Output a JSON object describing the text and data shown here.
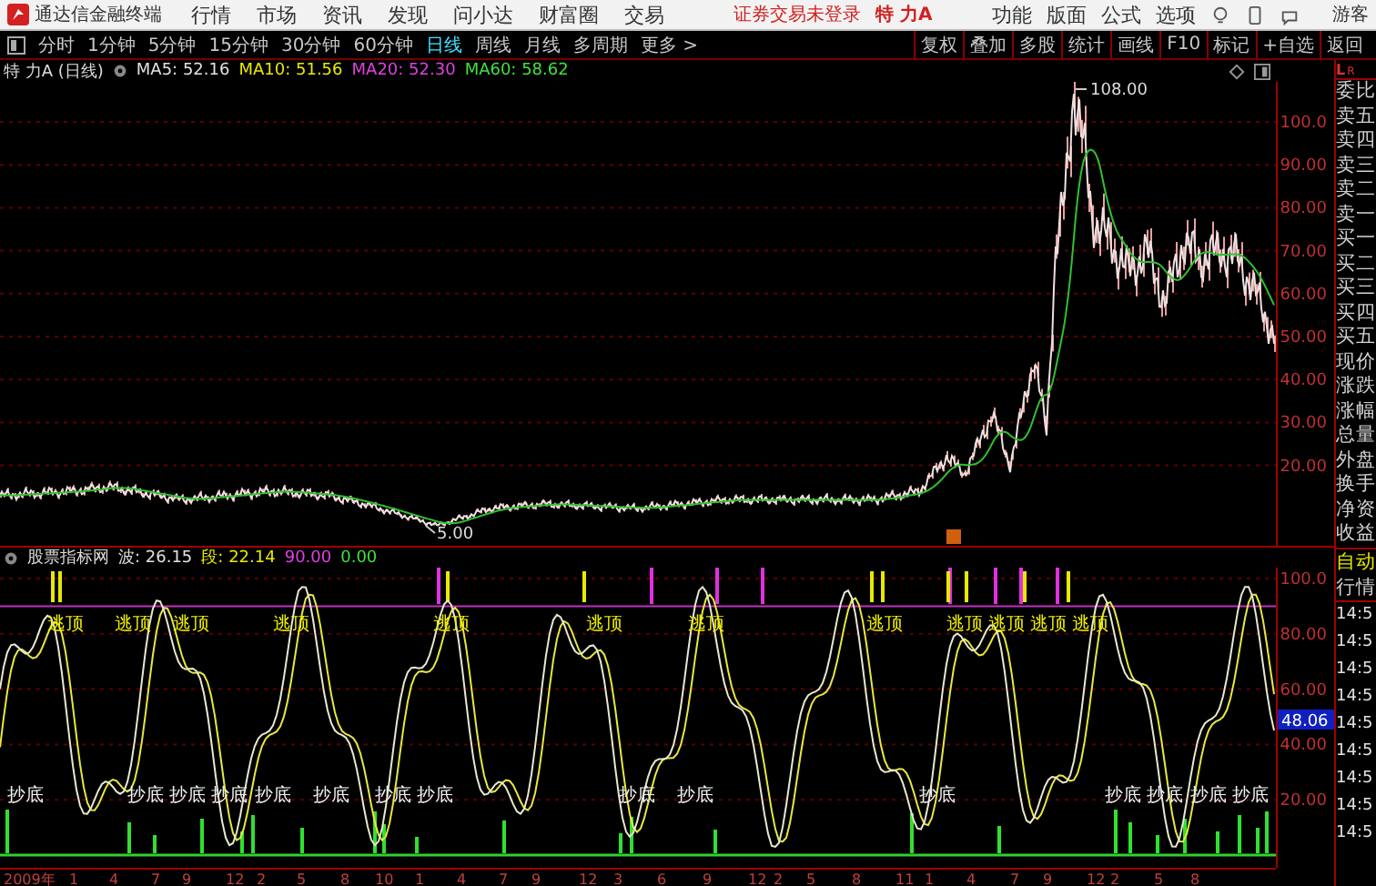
{
  "menu_bar": {
    "app_name": "通达信金融终端",
    "menus": [
      "行情",
      "市场",
      "资讯",
      "发现",
      "问小达",
      "财富圈",
      "交易"
    ],
    "login_notice": "证券交易未登录",
    "stock_name": "特 力A",
    "right_menus": [
      "功能",
      "版面",
      "公式",
      "选项"
    ],
    "user": "游客"
  },
  "period_tabs": [
    {
      "label": "分时",
      "selected": false
    },
    {
      "label": "1分钟",
      "selected": false
    },
    {
      "label": "5分钟",
      "selected": false
    },
    {
      "label": "15分钟",
      "selected": false
    },
    {
      "label": "30分钟",
      "selected": false
    },
    {
      "label": "60分钟",
      "selected": false
    },
    {
      "label": "日线",
      "selected": true
    },
    {
      "label": "周线",
      "selected": false
    },
    {
      "label": "月线",
      "selected": false
    },
    {
      "label": "多周期",
      "selected": false
    },
    {
      "label": "更多 >",
      "selected": false
    }
  ],
  "tool_buttons": [
    "复权",
    "叠加",
    "多股",
    "统计",
    "画线",
    "F10",
    "标记",
    "+自选",
    "返回"
  ],
  "price_chart": {
    "title": "特 力A (日线)",
    "indicators": [
      {
        "label": "MA5: 52.16",
        "color": "#e0e0e0"
      },
      {
        "label": "MA10: 51.56",
        "color": "#e8e800"
      },
      {
        "label": "MA20: 52.30",
        "color": "#e040e0"
      },
      {
        "label": "MA60: 58.62",
        "color": "#40e040"
      }
    ],
    "high_label": "108.00",
    "low_label": "5.00",
    "axis_labels": [
      "100.0",
      "90.00",
      "80.00",
      "70.00",
      "60.00",
      "50.00",
      "40.00",
      "30.00",
      "20.00"
    ]
  },
  "indicator_chart": {
    "title": "股票指标网",
    "indicators": [
      {
        "label": "波: 26.15",
        "color": "#e0e0e0"
      },
      {
        "label": "段: 22.14",
        "color": "#e8e800"
      },
      {
        "label": "90.00",
        "color": "#e040e0"
      },
      {
        "label": "0.00",
        "color": "#40e040"
      }
    ],
    "axis_labels": [
      "100.0",
      "80.00",
      "60.00",
      "40.00",
      "20.00"
    ],
    "current_value": "48.06",
    "signals": [
      {
        "kind": "top",
        "text": "逃顶"
      },
      {
        "kind": "top",
        "text": "逃顶"
      },
      {
        "kind": "top",
        "text": "逃顶"
      },
      {
        "kind": "top",
        "text": "逃顶"
      },
      {
        "kind": "top",
        "text": "逃顶"
      },
      {
        "kind": "top",
        "text": "逃顶"
      },
      {
        "kind": "top",
        "text": "逃顶"
      },
      {
        "kind": "top",
        "text": "逃顶"
      },
      {
        "kind": "top",
        "text": "逃顶"
      },
      {
        "kind": "top",
        "text": "逃顶"
      },
      {
        "kind": "top",
        "text": "逃顶"
      },
      {
        "kind": "top",
        "text": "逃顶"
      },
      {
        "kind": "bottom",
        "text": "抄底"
      },
      {
        "kind": "bottom",
        "text": "抄底"
      },
      {
        "kind": "bottom",
        "text": "抄底"
      },
      {
        "kind": "bottom",
        "text": "抄底"
      },
      {
        "kind": "bottom",
        "text": "抄底"
      },
      {
        "kind": "bottom",
        "text": "抄底"
      },
      {
        "kind": "bottom",
        "text": "抄底"
      },
      {
        "kind": "bottom",
        "text": "抄底"
      },
      {
        "kind": "bottom",
        "text": "抄底"
      },
      {
        "kind": "bottom",
        "text": "抄底"
      },
      {
        "kind": "bottom",
        "text": "抄底"
      },
      {
        "kind": "bottom",
        "text": "抄底"
      },
      {
        "kind": "bottom",
        "text": "抄底"
      },
      {
        "kind": "bottom",
        "text": "抄底"
      },
      {
        "kind": "bottom",
        "text": "抄底"
      }
    ]
  },
  "date_axis": [
    "2009年",
    "1",
    "4",
    "7",
    "9",
    "12",
    "2",
    "5",
    "8",
    "10",
    "1",
    "4",
    "7",
    "9",
    "12",
    "3",
    "6",
    "9",
    "12",
    "2",
    "5",
    "8",
    "11",
    "1",
    "4",
    "7",
    "9",
    "12",
    "2",
    "5",
    "8"
  ],
  "side_panel": {
    "header": [
      "L",
      "R"
    ],
    "items": [
      "委比",
      "卖五",
      "卖四",
      "卖三",
      "卖二",
      "卖一",
      "买一",
      "买二",
      "买三",
      "买四",
      "买五",
      "现价",
      "涨跌",
      "涨幅",
      "总量",
      "外盘",
      "换手",
      "净资",
      "收益"
    ],
    "mode": [
      "自动",
      "行情"
    ],
    "times": [
      "14:5",
      "14:5",
      "14:5",
      "14:5",
      "14:5",
      "14:5",
      "14:5",
      "14:5",
      "14:5"
    ]
  }
}
